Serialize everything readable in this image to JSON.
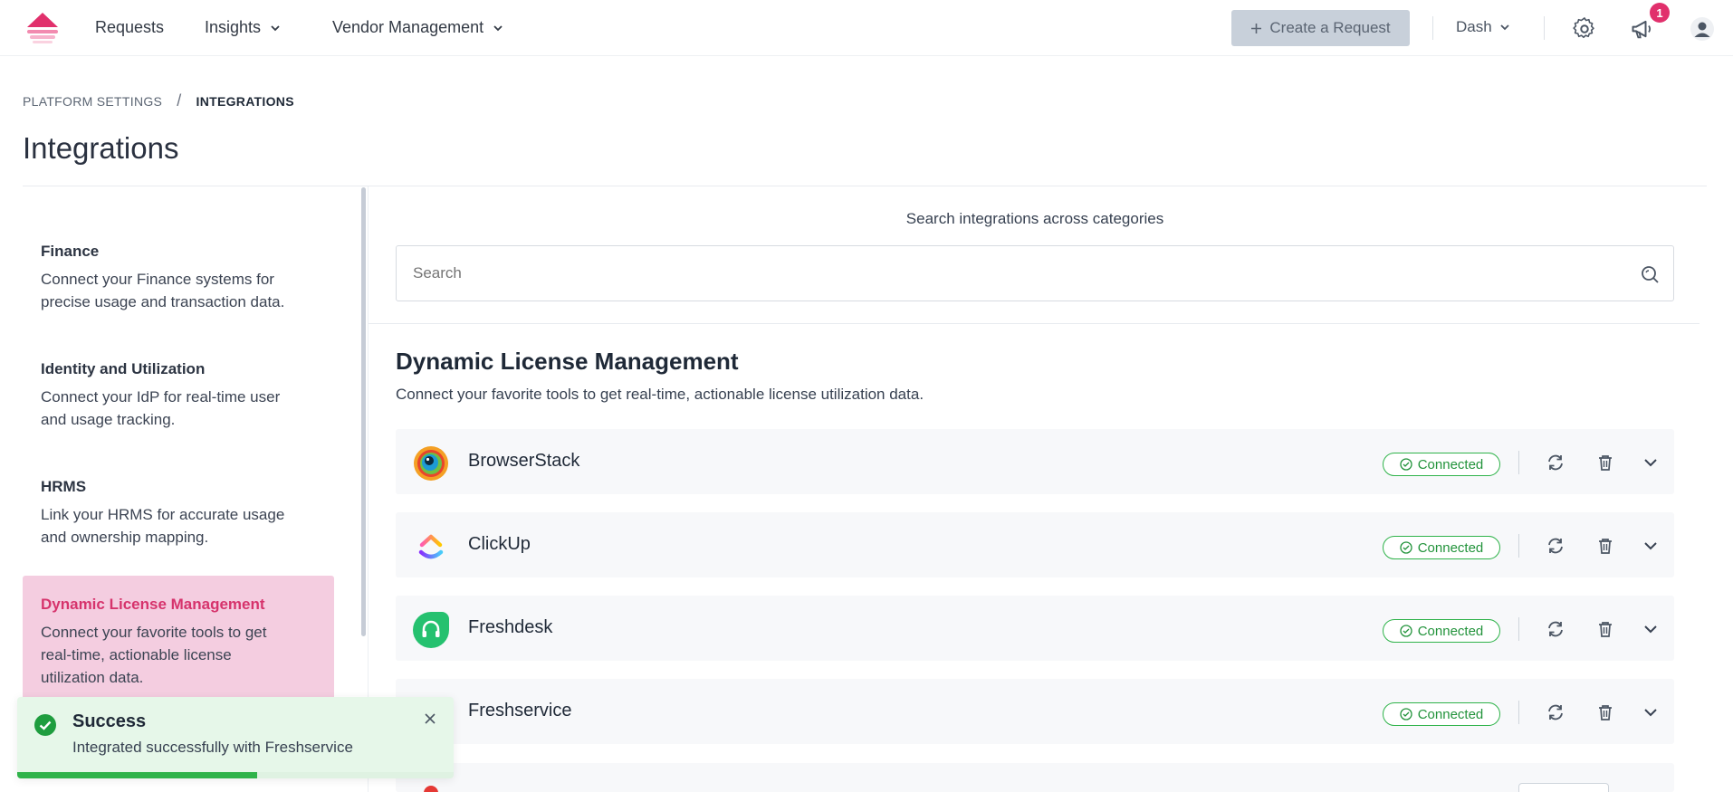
{
  "nav": {
    "items": [
      {
        "label": "Requests",
        "has_dropdown": false
      },
      {
        "label": "Insights",
        "has_dropdown": true
      },
      {
        "label": "Vendor Management",
        "has_dropdown": true
      }
    ],
    "create_button": "Create a Request",
    "user_menu": "Dash",
    "notification_count": "1",
    "icons": [
      "gear-icon",
      "megaphone-icon",
      "user-avatar-icon"
    ]
  },
  "breadcrumb": {
    "parent": "PLATFORM SETTINGS",
    "separator": "/",
    "current": "INTEGRATIONS"
  },
  "page_title": "Integrations",
  "categories": [
    {
      "title": "Finance",
      "desc": [
        "Connect your Finance systems for",
        "precise usage and transaction data."
      ],
      "active": false
    },
    {
      "title": "Identity and Utilization",
      "desc": [
        "Connect your IdP for real-time user",
        "and usage tracking."
      ],
      "active": false
    },
    {
      "title": "HRMS",
      "desc": [
        "Link your HRMS for accurate usage",
        "and ownership mapping."
      ],
      "active": false
    },
    {
      "title": "Dynamic License Management",
      "desc": [
        "Connect your favorite tools to get",
        "real-time, actionable license",
        "utilization data."
      ],
      "active": true
    }
  ],
  "search": {
    "label": "Search integrations across categories",
    "placeholder": "Search"
  },
  "section": {
    "title": "Dynamic License Management",
    "desc": "Connect your favorite tools to get real-time, actionable license utilization data."
  },
  "integrations": [
    {
      "name": "BrowserStack",
      "status": "Connected",
      "logo": "browserstack-logo"
    },
    {
      "name": "ClickUp",
      "status": "Connected",
      "logo": "clickup-logo"
    },
    {
      "name": "Freshdesk",
      "status": "Connected",
      "logo": "freshdesk-logo"
    },
    {
      "name": "Freshservice",
      "status": "Connected",
      "logo": "freshservice-logo"
    }
  ],
  "toast": {
    "title": "Success",
    "message": "Integrated successfully with Freshservice",
    "progress": 0.55
  },
  "colors": {
    "accent": "#d6336c",
    "active_bg": "#f4cde0",
    "connected": "#2fb34a",
    "create_button_bg": "#c8d0da"
  }
}
